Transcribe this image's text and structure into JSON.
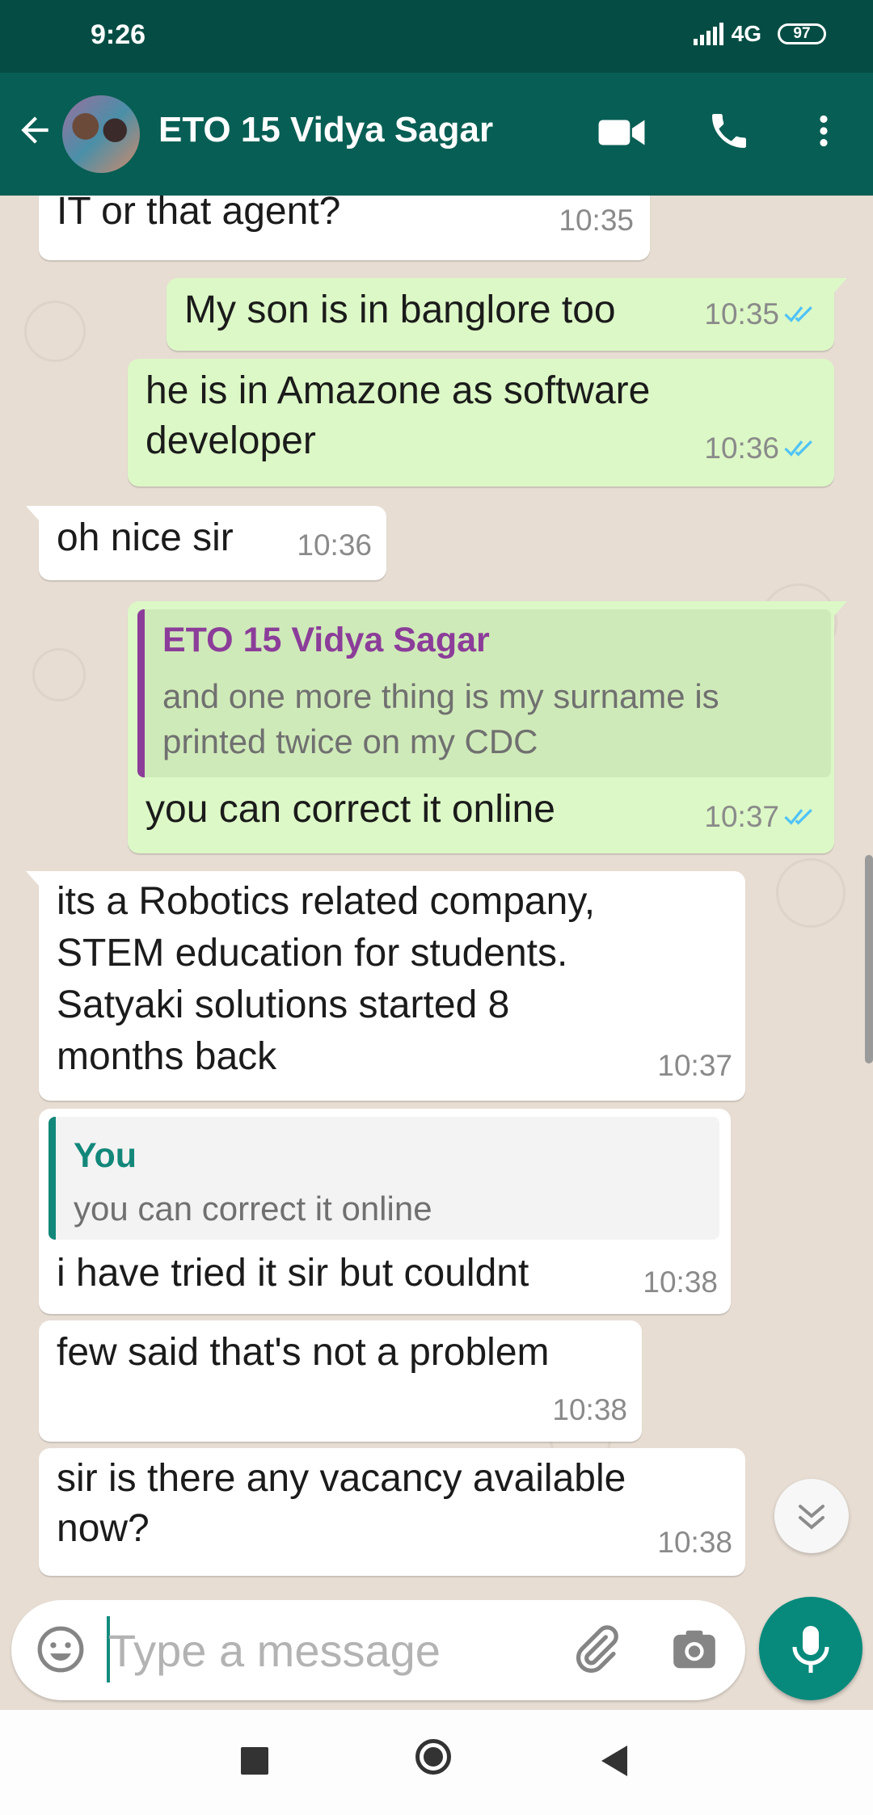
{
  "status_bar": {
    "time": "9:26",
    "network": "4G",
    "battery": "97"
  },
  "header": {
    "contact_name": "ETO 15 Vidya Sagar"
  },
  "messages": [
    {
      "direction": "in",
      "text_lines": [
        "IT or that agent?"
      ],
      "time": "10:35"
    },
    {
      "direction": "out",
      "text_lines": [
        "My son is in banglore too"
      ],
      "time": "10:35",
      "status": "read"
    },
    {
      "direction": "out",
      "text_lines": [
        "he is in Amazone as software",
        "developer"
      ],
      "time": "10:36",
      "status": "read"
    },
    {
      "direction": "in",
      "text_lines": [
        "oh nice sir"
      ],
      "time": "10:36"
    },
    {
      "direction": "out",
      "quote": {
        "author": "ETO 15 Vidya Sagar",
        "text_lines": [
          "and one more thing is my surname is",
          "printed twice on my CDC"
        ]
      },
      "text_lines": [
        "you can correct it online"
      ],
      "time": "10:37",
      "status": "read"
    },
    {
      "direction": "in",
      "text_lines": [
        "its a Robotics related company,",
        "STEM education for students.",
        "Satyaki solutions started 8",
        "months back"
      ],
      "time": "10:37"
    },
    {
      "direction": "in",
      "quote": {
        "author": "You",
        "text_lines": [
          "you can correct it online"
        ]
      },
      "text_lines": [
        "i have tried it sir but couldnt"
      ],
      "time": "10:38"
    },
    {
      "direction": "in",
      "text_lines": [
        "few said that's not a problem"
      ],
      "time": "10:38"
    },
    {
      "direction": "in",
      "text_lines": [
        "sir is there any vacancy available",
        "now?"
      ],
      "time": "10:38"
    }
  ],
  "composer": {
    "placeholder": "Type a message"
  },
  "icons": {
    "back": "arrow-left-icon",
    "video": "video-call-icon",
    "call": "phone-icon",
    "menu": "more-vert-icon",
    "emoji": "emoji-icon",
    "attach": "paperclip-icon",
    "camera": "camera-icon",
    "mic": "mic-icon",
    "scroll": "chevron-double-down-icon",
    "read": "double-check-icon"
  },
  "colors": {
    "header": "#075e54",
    "status_bar": "#054d44",
    "outgoing": "#dcf8c6",
    "incoming": "#ffffff",
    "read_ticks": "#4fc3f7",
    "accent": "#078a7c"
  }
}
